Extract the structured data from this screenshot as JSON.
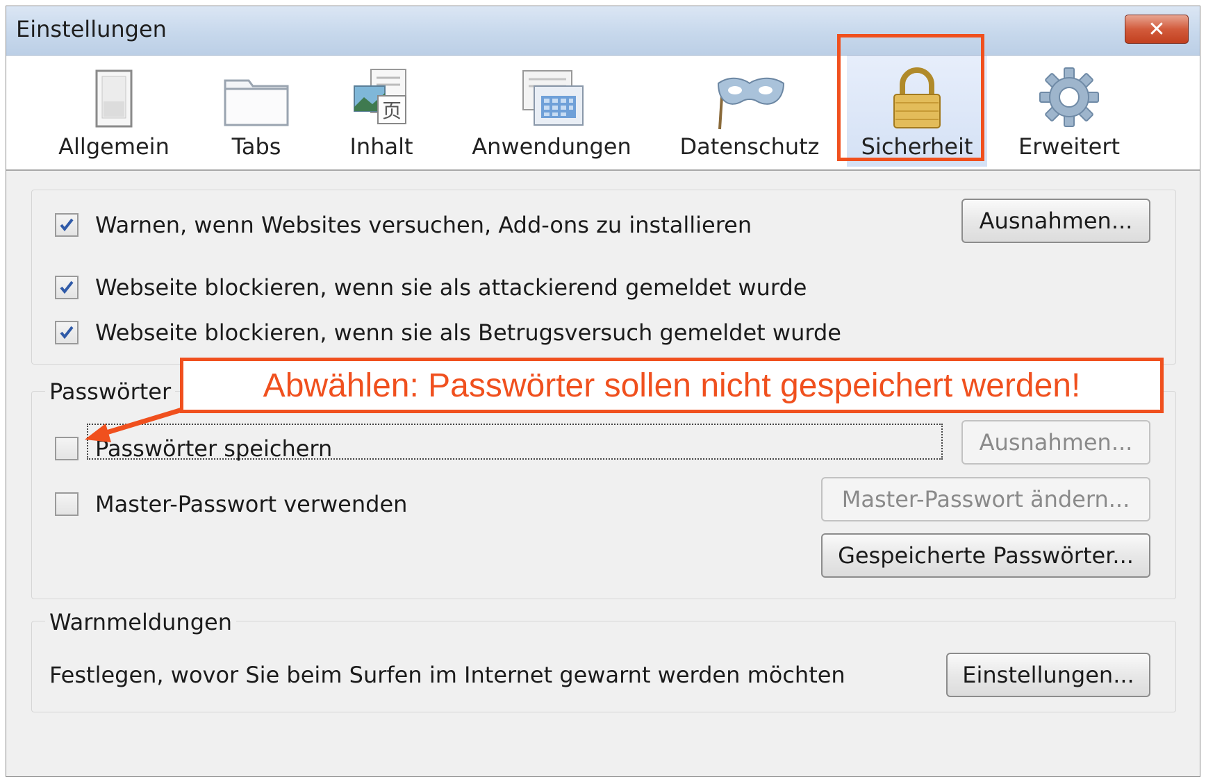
{
  "window": {
    "title": "Einstellungen",
    "close_label": "✕"
  },
  "toolbar": {
    "tabs": [
      {
        "label": "Allgemein",
        "icon": "switch-icon"
      },
      {
        "label": "Tabs",
        "icon": "folder-tabs-icon"
      },
      {
        "label": "Inhalt",
        "icon": "content-images-icon"
      },
      {
        "label": "Anwendungen",
        "icon": "applications-icon"
      },
      {
        "label": "Datenschutz",
        "icon": "mask-icon"
      },
      {
        "label": "Sicherheit",
        "icon": "padlock-icon",
        "selected": true
      },
      {
        "label": "Erweitert",
        "icon": "gear-icon"
      }
    ]
  },
  "security": {
    "warn_addons": {
      "label": "Warnen, wenn Websites versuchen, Add-ons zu installieren",
      "checked": true
    },
    "exceptions_button": "Ausnahmen...",
    "block_attack": {
      "label": "Webseite blockieren, wenn sie als attackierend gemeldet wurde",
      "checked": true
    },
    "block_fraud": {
      "label": "Webseite blockieren, wenn sie als Betrugsversuch gemeldet wurde",
      "checked": true
    }
  },
  "passwords": {
    "group_title": "Passwörter",
    "save_passwords": {
      "label": "Passwörter speichern",
      "checked": false
    },
    "exceptions_button": "Ausnahmen...",
    "master_password": {
      "label": "Master-Passwort verwenden",
      "checked": false
    },
    "change_master_button": "Master-Passwort ändern...",
    "saved_passwords_button": "Gespeicherte Passwörter..."
  },
  "warnings": {
    "group_title": "Warnmeldungen",
    "description": "Festlegen, wovor Sie beim Surfen im Internet gewarnt werden möchten",
    "settings_button": "Einstellungen..."
  },
  "annotation": {
    "text": "Abwählen: Passwörter sollen nicht gespeichert werden!",
    "color": "#f0501e"
  },
  "colors": {
    "accent": "#f0501e",
    "checkbox_check": "#2f5aa8"
  }
}
